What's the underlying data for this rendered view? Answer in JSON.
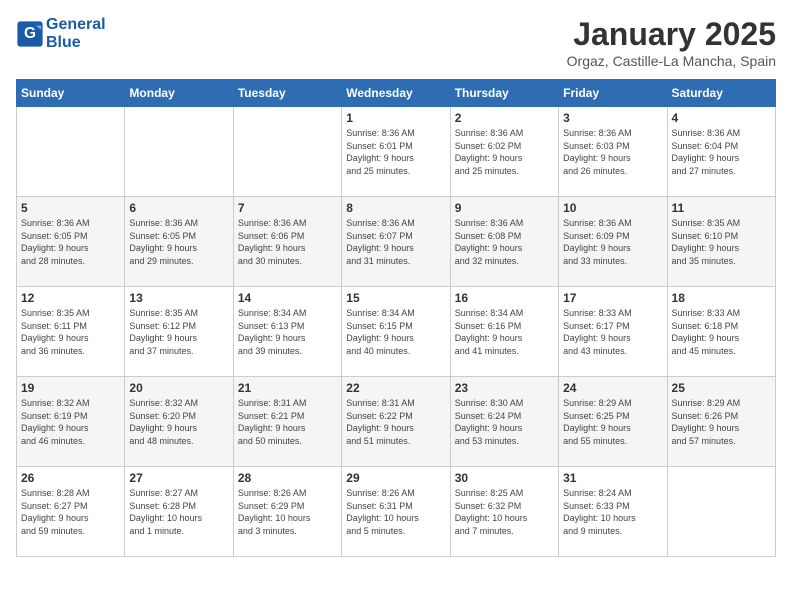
{
  "header": {
    "logo_line1": "General",
    "logo_line2": "Blue",
    "month_title": "January 2025",
    "location": "Orgaz, Castille-La Mancha, Spain"
  },
  "weekdays": [
    "Sunday",
    "Monday",
    "Tuesday",
    "Wednesday",
    "Thursday",
    "Friday",
    "Saturday"
  ],
  "weeks": [
    [
      {
        "day": "",
        "info": ""
      },
      {
        "day": "",
        "info": ""
      },
      {
        "day": "",
        "info": ""
      },
      {
        "day": "1",
        "info": "Sunrise: 8:36 AM\nSunset: 6:01 PM\nDaylight: 9 hours\nand 25 minutes."
      },
      {
        "day": "2",
        "info": "Sunrise: 8:36 AM\nSunset: 6:02 PM\nDaylight: 9 hours\nand 25 minutes."
      },
      {
        "day": "3",
        "info": "Sunrise: 8:36 AM\nSunset: 6:03 PM\nDaylight: 9 hours\nand 26 minutes."
      },
      {
        "day": "4",
        "info": "Sunrise: 8:36 AM\nSunset: 6:04 PM\nDaylight: 9 hours\nand 27 minutes."
      }
    ],
    [
      {
        "day": "5",
        "info": "Sunrise: 8:36 AM\nSunset: 6:05 PM\nDaylight: 9 hours\nand 28 minutes."
      },
      {
        "day": "6",
        "info": "Sunrise: 8:36 AM\nSunset: 6:05 PM\nDaylight: 9 hours\nand 29 minutes."
      },
      {
        "day": "7",
        "info": "Sunrise: 8:36 AM\nSunset: 6:06 PM\nDaylight: 9 hours\nand 30 minutes."
      },
      {
        "day": "8",
        "info": "Sunrise: 8:36 AM\nSunset: 6:07 PM\nDaylight: 9 hours\nand 31 minutes."
      },
      {
        "day": "9",
        "info": "Sunrise: 8:36 AM\nSunset: 6:08 PM\nDaylight: 9 hours\nand 32 minutes."
      },
      {
        "day": "10",
        "info": "Sunrise: 8:36 AM\nSunset: 6:09 PM\nDaylight: 9 hours\nand 33 minutes."
      },
      {
        "day": "11",
        "info": "Sunrise: 8:35 AM\nSunset: 6:10 PM\nDaylight: 9 hours\nand 35 minutes."
      }
    ],
    [
      {
        "day": "12",
        "info": "Sunrise: 8:35 AM\nSunset: 6:11 PM\nDaylight: 9 hours\nand 36 minutes."
      },
      {
        "day": "13",
        "info": "Sunrise: 8:35 AM\nSunset: 6:12 PM\nDaylight: 9 hours\nand 37 minutes."
      },
      {
        "day": "14",
        "info": "Sunrise: 8:34 AM\nSunset: 6:13 PM\nDaylight: 9 hours\nand 39 minutes."
      },
      {
        "day": "15",
        "info": "Sunrise: 8:34 AM\nSunset: 6:15 PM\nDaylight: 9 hours\nand 40 minutes."
      },
      {
        "day": "16",
        "info": "Sunrise: 8:34 AM\nSunset: 6:16 PM\nDaylight: 9 hours\nand 41 minutes."
      },
      {
        "day": "17",
        "info": "Sunrise: 8:33 AM\nSunset: 6:17 PM\nDaylight: 9 hours\nand 43 minutes."
      },
      {
        "day": "18",
        "info": "Sunrise: 8:33 AM\nSunset: 6:18 PM\nDaylight: 9 hours\nand 45 minutes."
      }
    ],
    [
      {
        "day": "19",
        "info": "Sunrise: 8:32 AM\nSunset: 6:19 PM\nDaylight: 9 hours\nand 46 minutes."
      },
      {
        "day": "20",
        "info": "Sunrise: 8:32 AM\nSunset: 6:20 PM\nDaylight: 9 hours\nand 48 minutes."
      },
      {
        "day": "21",
        "info": "Sunrise: 8:31 AM\nSunset: 6:21 PM\nDaylight: 9 hours\nand 50 minutes."
      },
      {
        "day": "22",
        "info": "Sunrise: 8:31 AM\nSunset: 6:22 PM\nDaylight: 9 hours\nand 51 minutes."
      },
      {
        "day": "23",
        "info": "Sunrise: 8:30 AM\nSunset: 6:24 PM\nDaylight: 9 hours\nand 53 minutes."
      },
      {
        "day": "24",
        "info": "Sunrise: 8:29 AM\nSunset: 6:25 PM\nDaylight: 9 hours\nand 55 minutes."
      },
      {
        "day": "25",
        "info": "Sunrise: 8:29 AM\nSunset: 6:26 PM\nDaylight: 9 hours\nand 57 minutes."
      }
    ],
    [
      {
        "day": "26",
        "info": "Sunrise: 8:28 AM\nSunset: 6:27 PM\nDaylight: 9 hours\nand 59 minutes."
      },
      {
        "day": "27",
        "info": "Sunrise: 8:27 AM\nSunset: 6:28 PM\nDaylight: 10 hours\nand 1 minute."
      },
      {
        "day": "28",
        "info": "Sunrise: 8:26 AM\nSunset: 6:29 PM\nDaylight: 10 hours\nand 3 minutes."
      },
      {
        "day": "29",
        "info": "Sunrise: 8:26 AM\nSunset: 6:31 PM\nDaylight: 10 hours\nand 5 minutes."
      },
      {
        "day": "30",
        "info": "Sunrise: 8:25 AM\nSunset: 6:32 PM\nDaylight: 10 hours\nand 7 minutes."
      },
      {
        "day": "31",
        "info": "Sunrise: 8:24 AM\nSunset: 6:33 PM\nDaylight: 10 hours\nand 9 minutes."
      },
      {
        "day": "",
        "info": ""
      }
    ]
  ]
}
